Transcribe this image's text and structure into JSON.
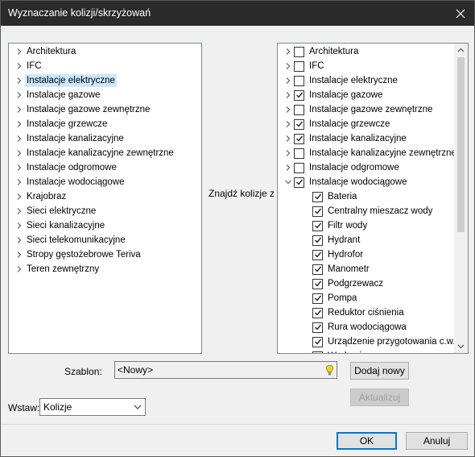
{
  "window": {
    "title": "Wyznaczanie kolizji/skrzyżowań"
  },
  "left_tree": {
    "items": [
      {
        "label": "Architektura",
        "selected": false
      },
      {
        "label": "IFC",
        "selected": false
      },
      {
        "label": "Instalacje elektryczne",
        "selected": true
      },
      {
        "label": "Instalacje gazowe",
        "selected": false
      },
      {
        "label": "Instalacje gazowe zewnętrzne",
        "selected": false
      },
      {
        "label": "Instalacje grzewcze",
        "selected": false
      },
      {
        "label": "Instalacje kanalizacyjne",
        "selected": false
      },
      {
        "label": "Instalacje kanalizacyjne zewnętrzne",
        "selected": false
      },
      {
        "label": "Instalacje odgromowe",
        "selected": false
      },
      {
        "label": "Instalacje wodociągowe",
        "selected": false
      },
      {
        "label": "Krajobraz",
        "selected": false
      },
      {
        "label": "Sieci elektryczne",
        "selected": false
      },
      {
        "label": "Sieci kanalizacyjne",
        "selected": false
      },
      {
        "label": "Sieci telekomunikacyjne",
        "selected": false
      },
      {
        "label": "Stropy gęstożebrowe Teriva",
        "selected": false
      },
      {
        "label": "Teren zewnętrzny",
        "selected": false
      }
    ]
  },
  "middle_label": "Znajdź kolizje z",
  "right_tree": {
    "items": [
      {
        "label": "Architektura",
        "checked": false,
        "expanded": false
      },
      {
        "label": "IFC",
        "checked": false,
        "expanded": false
      },
      {
        "label": "Instalacje elektryczne",
        "checked": false,
        "expanded": false
      },
      {
        "label": "Instalacje gazowe",
        "checked": true,
        "expanded": false
      },
      {
        "label": "Instalacje gazowe zewnętrzne",
        "checked": false,
        "expanded": false
      },
      {
        "label": "Instalacje grzewcze",
        "checked": true,
        "expanded": false
      },
      {
        "label": "Instalacje kanalizacyjne",
        "checked": true,
        "expanded": false
      },
      {
        "label": "Instalacje kanalizacyjne zewnętrzne",
        "checked": false,
        "expanded": false
      },
      {
        "label": "Instalacje odgromowe",
        "checked": false,
        "expanded": false
      },
      {
        "label": "Instalacje wodociągowe",
        "checked": true,
        "expanded": true
      }
    ],
    "children": [
      {
        "label": "Bateria",
        "checked": true
      },
      {
        "label": "Centralny mieszacz wody",
        "checked": true
      },
      {
        "label": "Filtr wody",
        "checked": true
      },
      {
        "label": "Hydrant",
        "checked": true
      },
      {
        "label": "Hydrofor",
        "checked": true
      },
      {
        "label": "Manometr",
        "checked": true
      },
      {
        "label": "Podgrzewacz",
        "checked": true
      },
      {
        "label": "Pompa",
        "checked": true
      },
      {
        "label": "Reduktor ciśnienia",
        "checked": true
      },
      {
        "label": "Rura wodociągowa",
        "checked": true
      },
      {
        "label": "Urządzenie przygotowania c.w.u.",
        "checked": true
      },
      {
        "label": "Wodomierz",
        "checked": true
      }
    ]
  },
  "template": {
    "label": "Szablon:",
    "value": "<Nowy>"
  },
  "buttons": {
    "add_new": "Dodaj nowy",
    "update": "Aktualizuj",
    "ok": "OK",
    "cancel": "Anuluj"
  },
  "insert": {
    "label": "Wstaw:",
    "value": "Kolizje"
  },
  "colors": {
    "titlebar": "#2b2b2b",
    "selection": "#cce8ff",
    "bulb": "#f2d21b"
  }
}
